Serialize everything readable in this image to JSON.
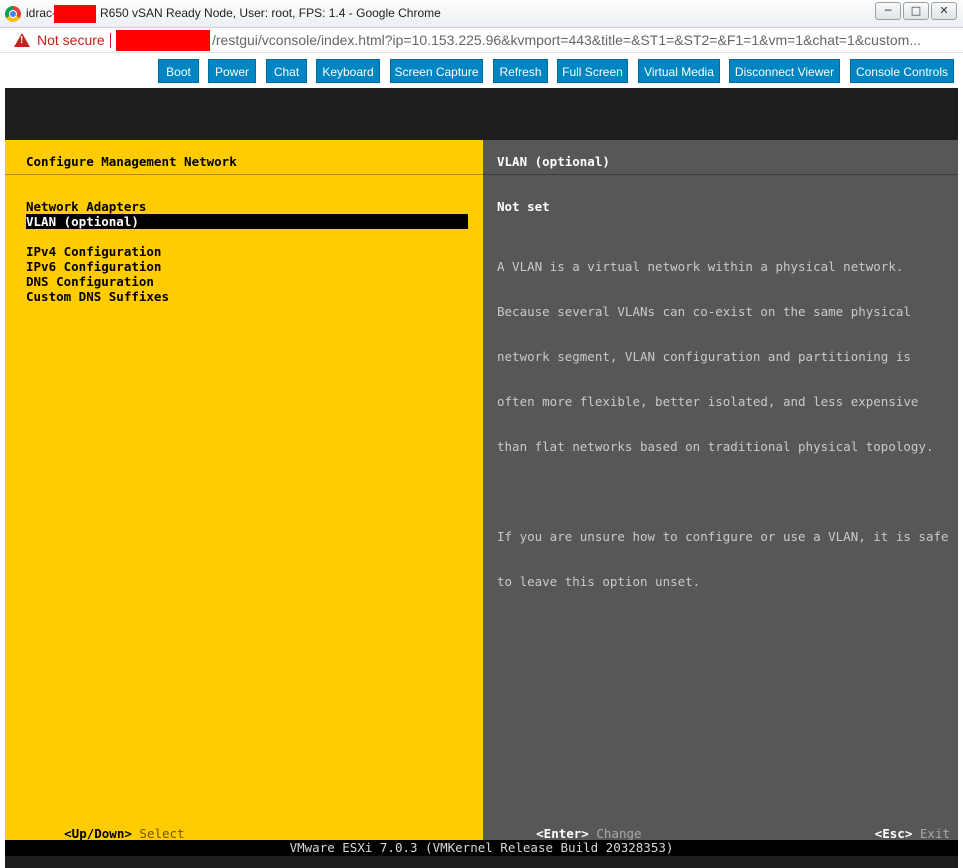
{
  "window": {
    "title_prefix": "idrac-",
    "title_suffix": "R650 vSAN Ready Node, User: root, FPS: 1.4 - Google Chrome",
    "minimize": "─",
    "maximize": "□",
    "close": "✕"
  },
  "address": {
    "security_label": "Not secure",
    "url": "/restgui/vconsole/index.html?ip=10.153.225.96&kvmport=443&title=&ST1=&ST2=&F1=1&vm=1&chat=1&custom..."
  },
  "toolbar": {
    "buttons": [
      "Boot",
      "Power",
      "Chat",
      "Keyboard",
      "Screen Capture",
      "Refresh",
      "Full Screen",
      "Virtual Media",
      "Disconnect Viewer",
      "Console Controls"
    ]
  },
  "esxi": {
    "left_title": "Configure Management Network",
    "menu": [
      "Network Adapters",
      "VLAN (optional)",
      "IPv4 Configuration",
      "IPv6 Configuration",
      "DNS Configuration",
      "Custom DNS Suffixes"
    ],
    "selected_index": 1,
    "right_title": "VLAN (optional)",
    "value": "Not set",
    "description": [
      "A VLAN is a virtual network within a physical network.",
      "Because several VLANs can co-exist on the same physical",
      "network segment, VLAN configuration and partitioning is",
      "often more flexible, better isolated, and less expensive",
      "than flat networks based on traditional physical topology.",
      "",
      "If you are unsure how to configure or use a VLAN, it is safe",
      "to leave this option unset."
    ],
    "footer": {
      "updown_key": "<Up/Down>",
      "updown_action": "Select",
      "enter_key": "<Enter>",
      "enter_action": "Change",
      "esc_key": "<Esc>",
      "esc_action": "Exit"
    },
    "status": "VMware ESXi 7.0.3 (VMKernel Release Build 20328353)"
  }
}
